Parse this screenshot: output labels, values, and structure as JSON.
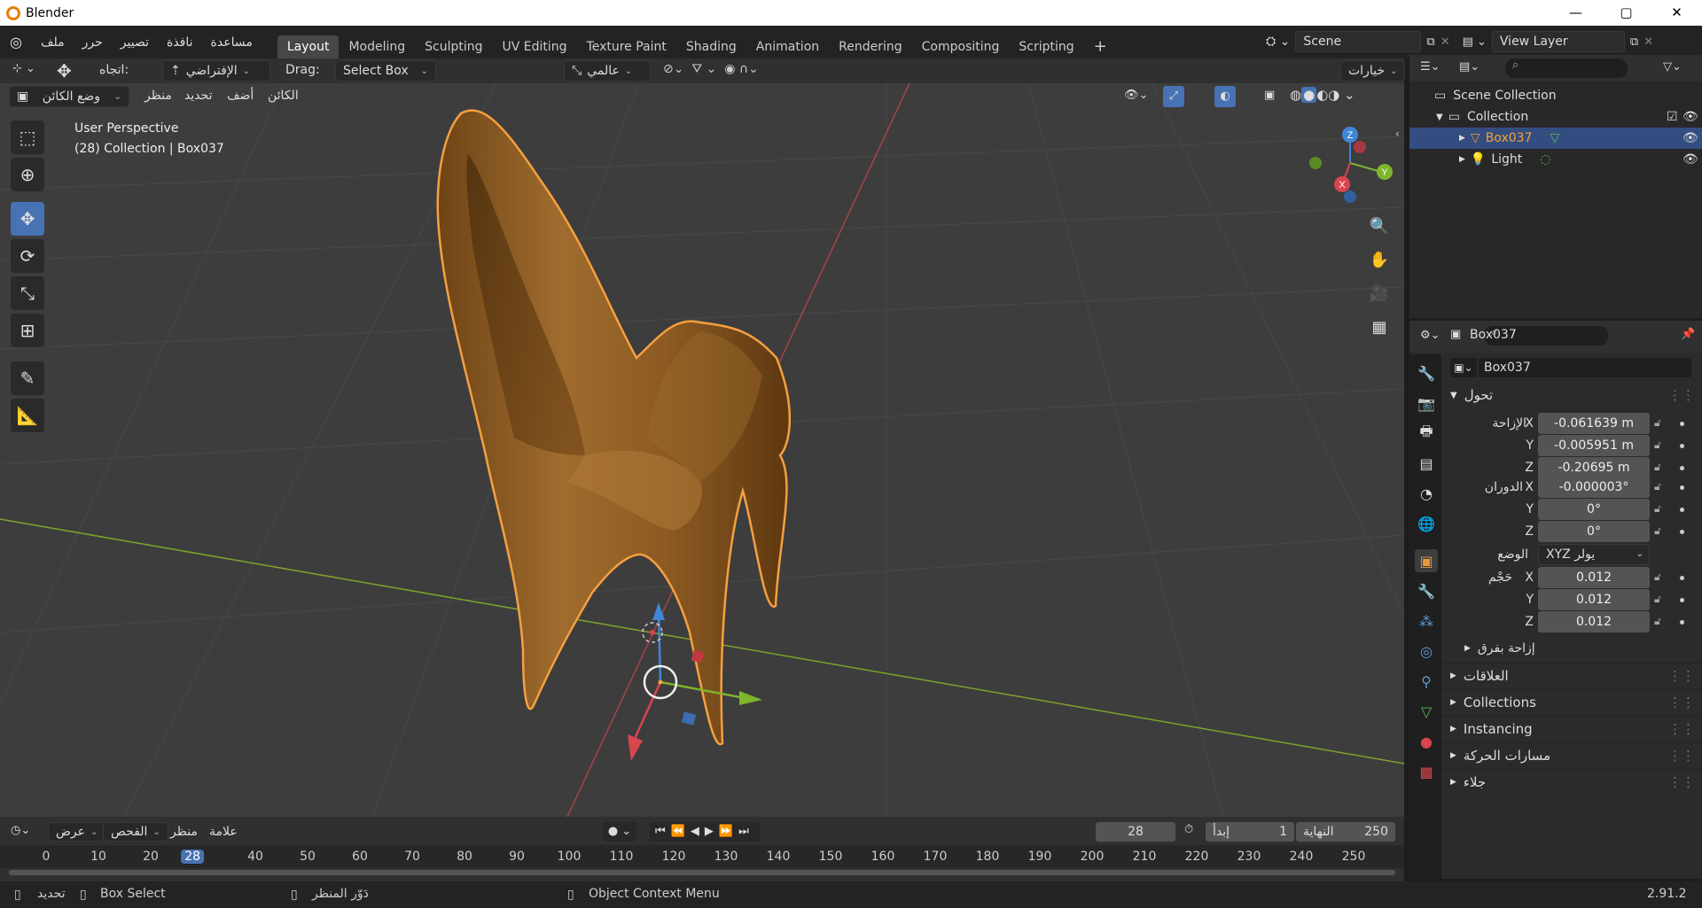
{
  "window": {
    "title": "Blender",
    "buttons": [
      "—",
      "▢",
      "✕"
    ]
  },
  "menu": {
    "items": [
      "ملف",
      "حرر",
      "تصيير",
      "نافذة",
      "مساعدة"
    ]
  },
  "workspaces": [
    "Layout",
    "Modeling",
    "Sculpting",
    "UV Editing",
    "Texture Paint",
    "Shading",
    "Animation",
    "Rendering",
    "Compositing",
    "Scripting"
  ],
  "active_workspace": "Layout",
  "scene": {
    "name": "Scene",
    "view_layer": "View Layer"
  },
  "viewport_header": {
    "orientation_label": "اتجاه:",
    "orientation_value": "الإفتراضي",
    "drag_label": "Drag:",
    "drag_value": "Select Box",
    "transform_space": "عالمي",
    "options": "خيارات",
    "mode": "وضع الكائن",
    "view": "منظر",
    "select": "تحديد",
    "add": "أضف",
    "object": "الكائن"
  },
  "viewport": {
    "perspective": "User Perspective",
    "collection_info": "(28) Collection | Box037",
    "gizmo": {
      "x": "X",
      "y": "Y",
      "z": "Z"
    }
  },
  "outliner": {
    "root": "Scene Collection",
    "collection": "Collection",
    "items": [
      {
        "name": "Box037",
        "selected": true
      },
      {
        "name": "Light",
        "selected": false
      }
    ]
  },
  "properties": {
    "object_name": "Box037",
    "data_name": "Box037",
    "transform_title": "تحول",
    "location_label": "الإزاحة",
    "rotation_label": "الدوران",
    "mode_label": "الوضع",
    "scale_label": "حَجْم",
    "location": [
      "-0.061639 m",
      "-0.005951 m",
      "-0.20695 m"
    ],
    "rotation": [
      "-0.000003°",
      "0°",
      "0°"
    ],
    "rotation_mode": "XYZ يولر",
    "scale": [
      "0.012",
      "0.012",
      "0.012"
    ],
    "axes": [
      "X",
      "Y",
      "Z"
    ],
    "delta": "إزاحة بفرق",
    "sections": [
      "العلاقات",
      "Collections",
      "Instancing",
      "مسارات الحركة",
      "جلاء"
    ]
  },
  "timeline": {
    "playback": "عرض",
    "keying": "الفحص",
    "view": "منظر",
    "marker": "علامة",
    "current_frame": "28",
    "start_label": "إبدأ",
    "start": "1",
    "end_label": "النهاية",
    "end": "250",
    "ticks": [
      "0",
      "10",
      "20",
      "28",
      "40",
      "50",
      "60",
      "70",
      "80",
      "90",
      "100",
      "110",
      "120",
      "130",
      "140",
      "150",
      "160",
      "170",
      "180",
      "190",
      "200",
      "210",
      "220",
      "230",
      "240",
      "250"
    ]
  },
  "status": {
    "select": "تحديد",
    "box_select": "Box Select",
    "rotate_view": "دَوّر المنظر",
    "context_menu": "Object Context Menu",
    "version": "2.91.2"
  },
  "colors": {
    "accent": "#4772b3",
    "selection_outline": "#f5a040",
    "model": "#8b5a22",
    "x_axis": "#d9454e",
    "y_axis": "#7fb52b",
    "z_axis": "#3f86d6"
  }
}
